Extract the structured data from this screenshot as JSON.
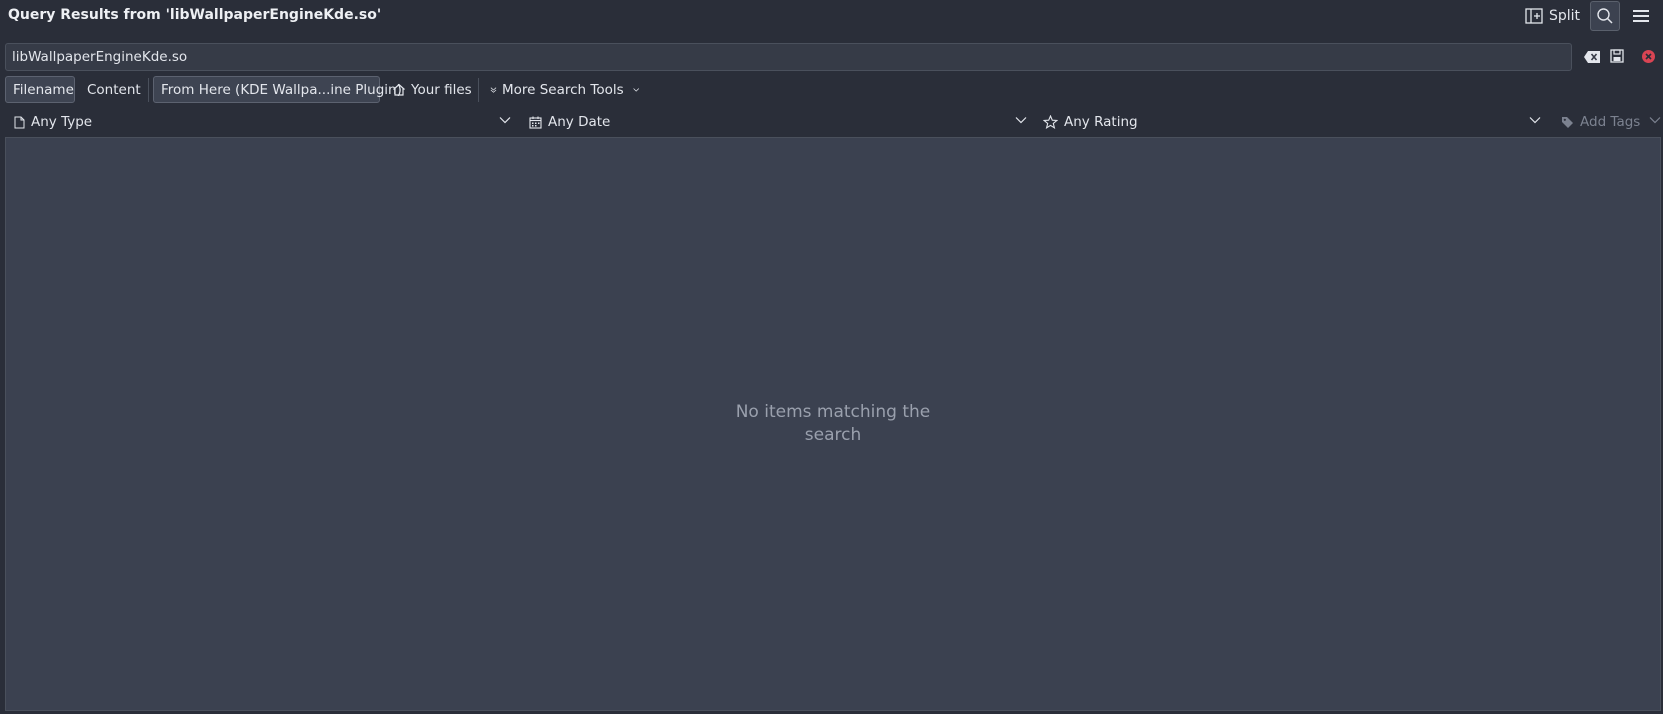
{
  "window": {
    "title": "Query Results from 'libWallpaperEngineKde.so'",
    "split_label": "Split"
  },
  "search": {
    "value": "libWallpaperEngineKde.so",
    "placeholder": ""
  },
  "toolbar": {
    "filename_label": "Filename",
    "content_label": "Content",
    "from_here_label": "From Here (KDE Wallpa...ine Plugin)",
    "your_files_label": "Your files",
    "more_tools_label": "More Search Tools"
  },
  "filters": {
    "type_label": "Any Type",
    "date_label": "Any Date",
    "rating_label": "Any Rating",
    "tags_label": "Add Tags"
  },
  "results": {
    "empty_message": "No items matching the search"
  },
  "colors": {
    "background": "#2a2e39",
    "panel": "#3b4150",
    "close_red": "#da4453",
    "text": "#e3e6ec"
  }
}
